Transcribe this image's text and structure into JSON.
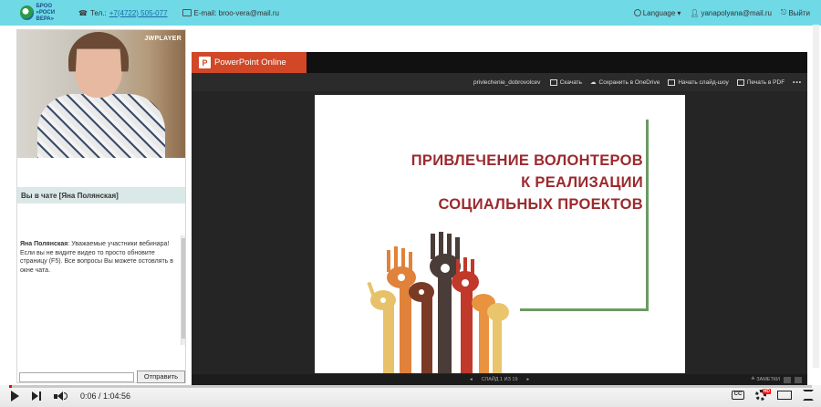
{
  "header": {
    "logo_lines": [
      "БРОО «РОСИ",
      "ВЕРА»"
    ],
    "phone_label": "Тел.:",
    "phone_value": "+7(4722) 505-077",
    "email_label": "E-mail: broo-vera@mail.ru",
    "language_label": "Language",
    "user_email": "yanapolyana@mail.ru",
    "logout_label": "Выйти"
  },
  "left": {
    "video_overlay": "JWPLAYER",
    "chat_header": "Вы в чате [Яна Полянская]",
    "chat_messages": [
      {
        "author": "Яна Полянская",
        "text": ": Уважаемые участники вебинара! Если вы не видите видео то просто обновите страницу (F5). Все вопросы Вы можете остовлять в окне чата."
      }
    ],
    "chat_input_value": "",
    "send_button": "Отправить"
  },
  "ppt": {
    "brand": "PowerPoint Online",
    "logo_letter": "P",
    "filename": "privlechenie_dobrovolcev",
    "tools": [
      "Скачать",
      "Сохранить в OneDrive",
      "Начать слайд-шоу",
      "Печать в PDF"
    ],
    "more_label": "•••",
    "slide": {
      "title_lines": [
        "ПРИВЛЕЧЕНИЕ ВОЛОНТЕРОВ",
        "К РЕАЛИЗАЦИИ",
        "СОЦИАЛЬНЫХ ПРОЕКТОВ"
      ]
    },
    "footer": {
      "prev": "◂",
      "counter": "СЛАЙД 1 ИЗ 19",
      "next": "▸",
      "notes": "≙ ЗАМЕТКИ"
    }
  },
  "player": {
    "time": "0:06 / 1:04:56",
    "progress_fraction": 0.002,
    "cc": "CC",
    "hd_badge": "HD"
  },
  "colors": {
    "topbar": "#6fd9e6",
    "ppt_brand": "#d24726",
    "slide_title": "#9b2a2e",
    "slide_lines": "#6b9a63",
    "progress": "#ff0000"
  },
  "icons": [
    "phone-icon",
    "mail-icon",
    "globe-icon",
    "user-icon",
    "logout-icon",
    "download-icon",
    "cloud-icon",
    "slideshow-icon",
    "print-icon",
    "play-icon",
    "next-icon",
    "volume-icon",
    "captions-icon",
    "settings-icon",
    "theater-icon",
    "fullscreen-icon"
  ]
}
